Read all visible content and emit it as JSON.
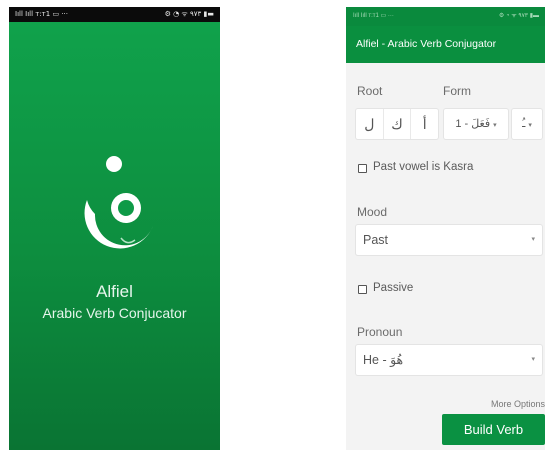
{
  "splash": {
    "status_left": "Iıll Iıll ᴛ:ᴛ1 ▭ ···",
    "status_right": "⚙ ◔ ᯤ ٩٧٣ ▮▬",
    "title": "Alfiel",
    "subtitle": "Arabic Verb Conjucator",
    "logo_icon": "fa-letter-logo-icon"
  },
  "app": {
    "status_left": "Iıll Iıll ᴛ:ᴛ1 ▭ ···",
    "status_right": "⚙ ◔ ᯤ ٩٧٣ ▮▬",
    "title": "Alfiel - Arabic Verb Conjugator",
    "root_label": "Root",
    "root_letters": [
      "ل",
      "ك",
      "أ"
    ],
    "form_label": "Form",
    "form_value": "فَعَلَ - 1",
    "vowel_value": "ـُ",
    "past_vowel_label": "Past vowel is Kasra",
    "past_vowel_checked": false,
    "mood_label": "Mood",
    "mood_value": "Past",
    "passive_label": "Passive",
    "passive_checked": false,
    "pronoun_label": "Pronoun",
    "pronoun_value": "He - هُوَ",
    "more_options_label": "More Options",
    "build_button_label": "Build Verb"
  },
  "colors": {
    "brand_green": "#0a8f3f",
    "splash_green": "#10a34c",
    "button_green": "#0a9142"
  }
}
